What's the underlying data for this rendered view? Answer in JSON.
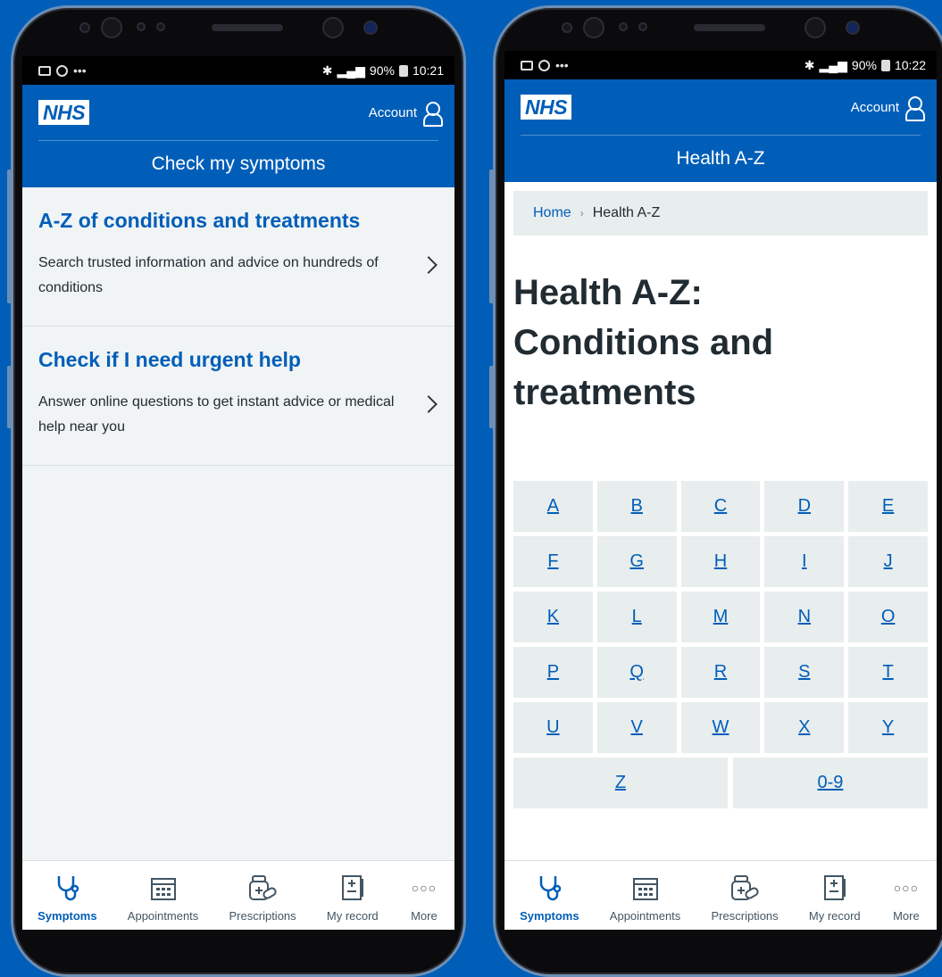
{
  "left_phone": {
    "status": {
      "time": "10:21",
      "battery": "90%"
    },
    "header": {
      "logo": "NHS",
      "account": "Account",
      "section_title": "Check my symptoms"
    },
    "cards": [
      {
        "title": "A-Z of conditions and treatments",
        "description": "Search trusted information and advice on hundreds of conditions"
      },
      {
        "title": "Check if I need urgent help",
        "description": "Answer online questions to get instant advice or medical help near you"
      }
    ]
  },
  "right_phone": {
    "status": {
      "time": "10:22",
      "battery": "90%"
    },
    "header": {
      "logo": "NHS",
      "account": "Account",
      "section_title": "Health A-Z"
    },
    "breadcrumb": {
      "home": "Home",
      "current": "Health A-Z"
    },
    "page_title_lines": [
      "Health A-Z:",
      "Conditions and",
      "treatments"
    ],
    "letters": [
      "A",
      "B",
      "C",
      "D",
      "E",
      "F",
      "G",
      "H",
      "I",
      "J",
      "K",
      "L",
      "M",
      "N",
      "O",
      "P",
      "Q",
      "R",
      "S",
      "T",
      "U",
      "V",
      "W",
      "X",
      "Y"
    ],
    "last_row": [
      "Z",
      "0-9"
    ]
  },
  "tabbar": {
    "items": [
      {
        "label": "Symptoms",
        "icon": "stethoscope-icon",
        "active": true
      },
      {
        "label": "Appointments",
        "icon": "calendar-icon",
        "active": false
      },
      {
        "label": "Prescriptions",
        "icon": "pills-icon",
        "active": false
      },
      {
        "label": "My record",
        "icon": "record-icon",
        "active": false
      },
      {
        "label": "More",
        "icon": "more-dots-icon",
        "active": false
      }
    ]
  },
  "colors": {
    "background": "#005eb8",
    "nhs_blue": "#005eb8",
    "text": "#212b32",
    "panel": "#e8edee"
  }
}
